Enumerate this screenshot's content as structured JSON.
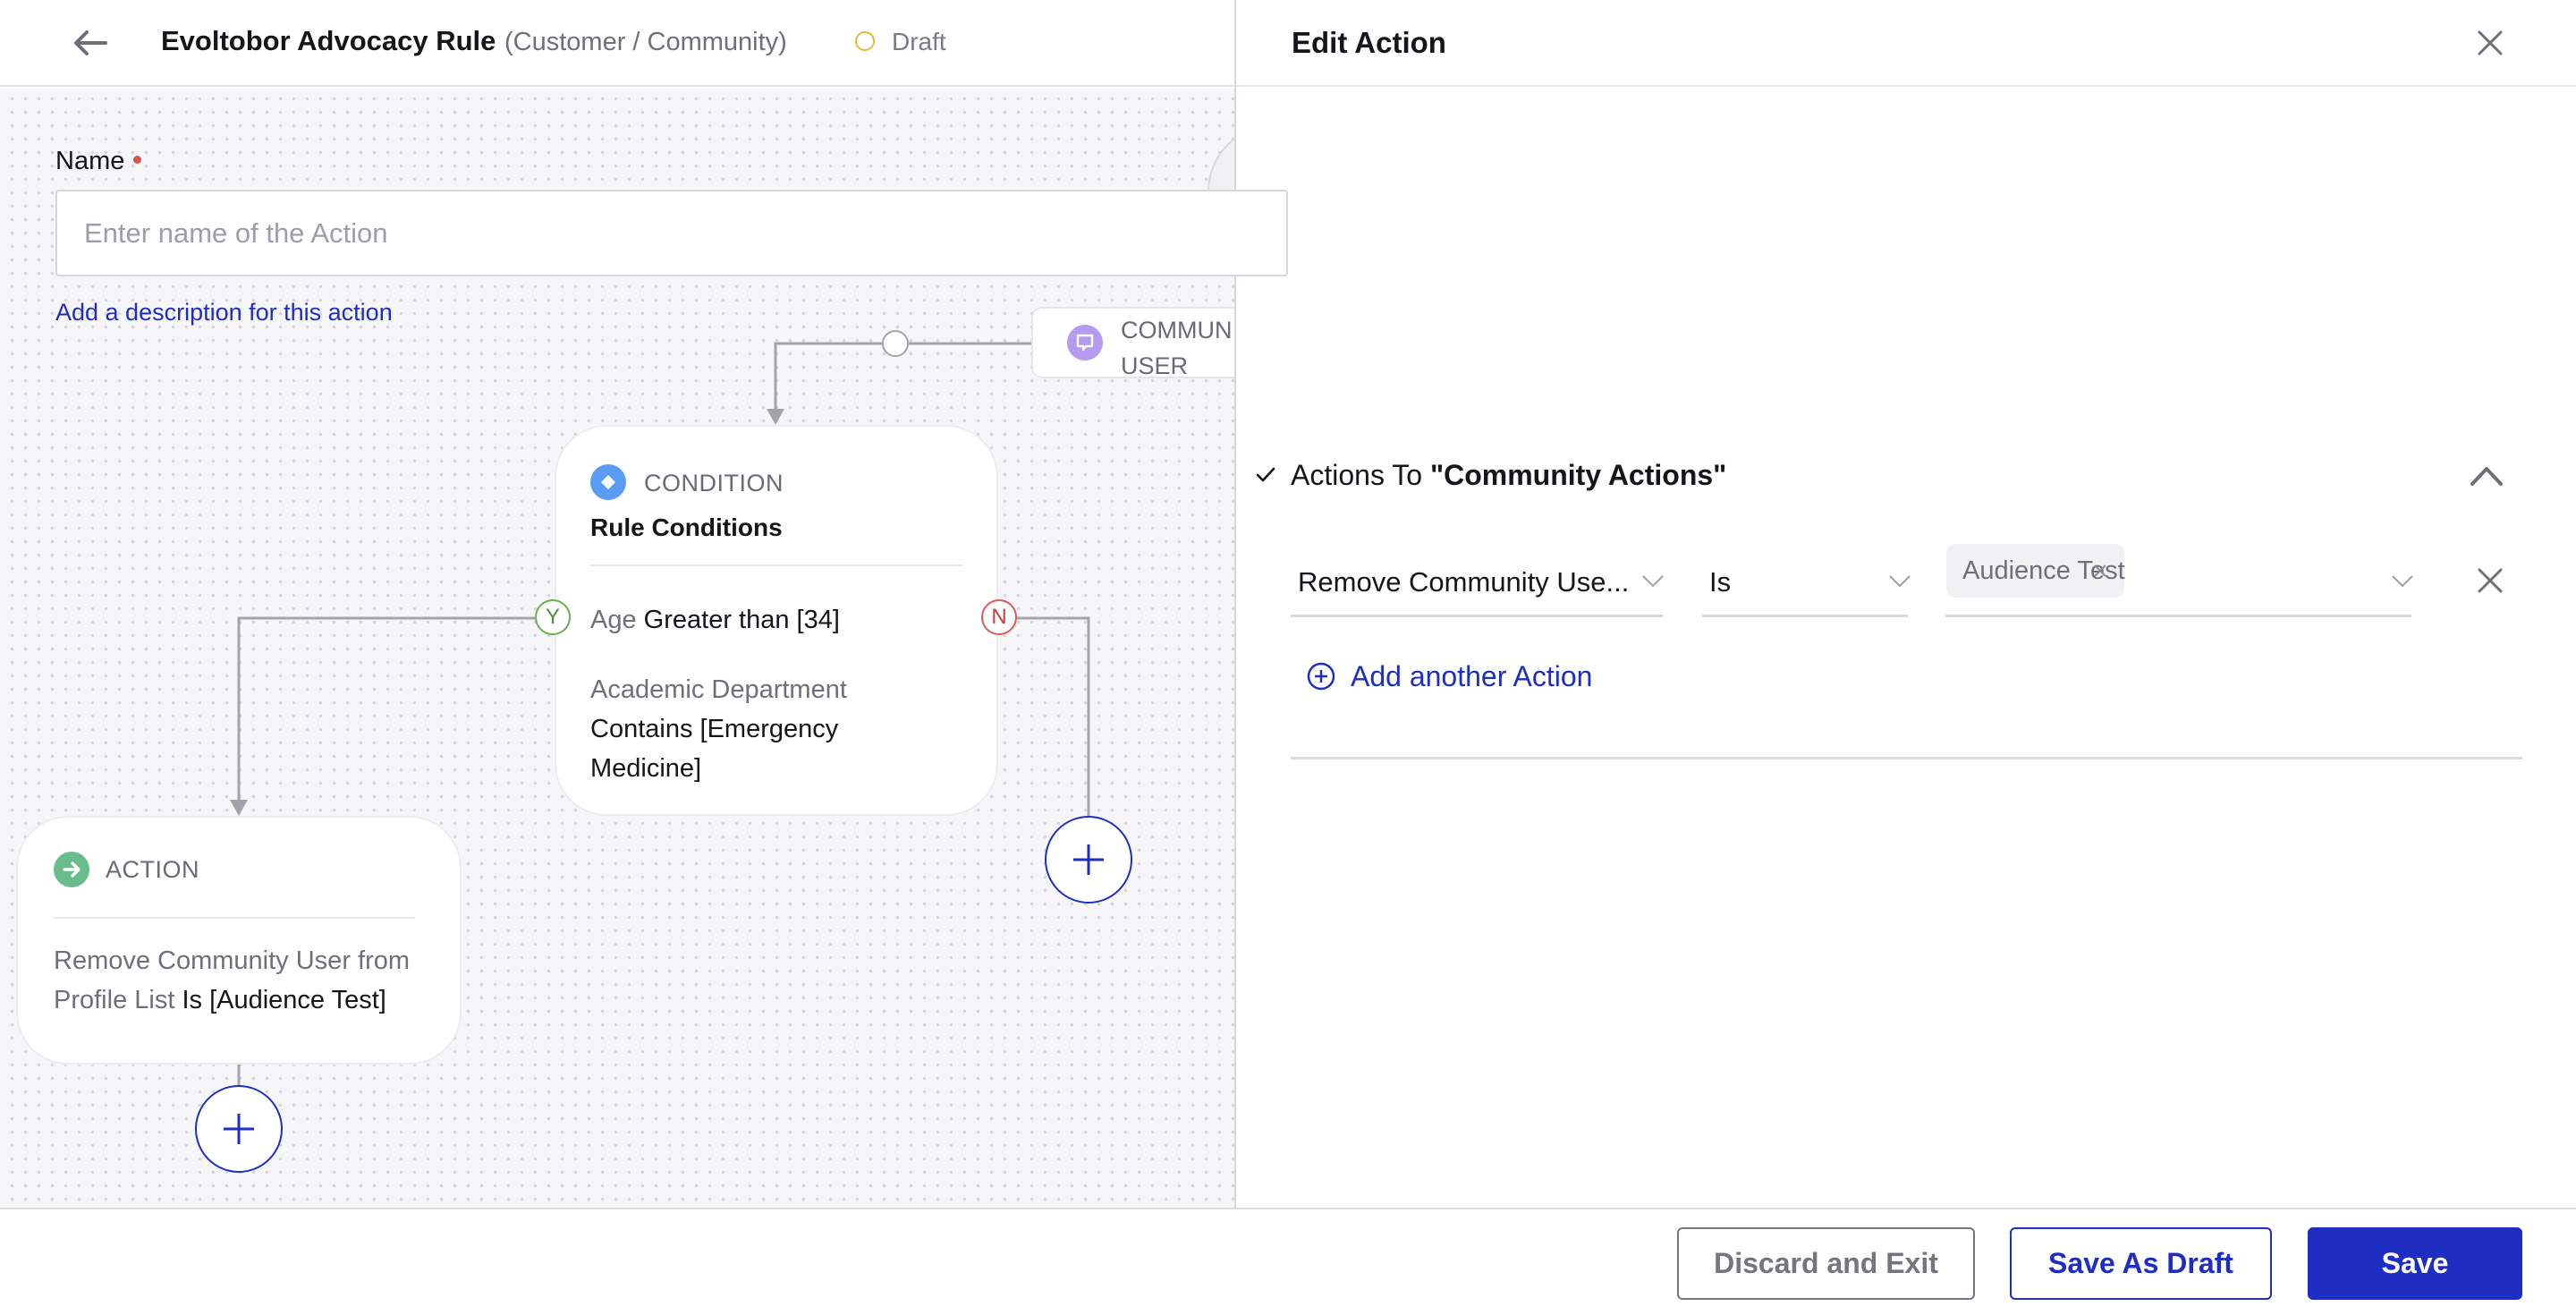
{
  "header": {
    "back_icon": "arrow-left-icon",
    "title": "Evoltobor Advocacy Rule",
    "subtitle": "(Customer / Community)",
    "status": "Draft",
    "status_color": "#e6b93a"
  },
  "canvas": {
    "trigger_node": {
      "icon": "chat-bubble-icon",
      "label": "COMMUN\nUSER",
      "icon_color": "#b59af0"
    },
    "condition_card": {
      "type": "CONDITION",
      "icon": "diamond-icon",
      "icon_color": "#5a9cf2",
      "title": "Rule Conditions",
      "conditions": [
        {
          "field": "Age",
          "rule": "Greater than [34]"
        },
        {
          "field": "Academic Department",
          "rule": "Contains [Emergency Medicine]"
        }
      ],
      "yes_label": "Y",
      "no_label": "N"
    },
    "action_card": {
      "type": "ACTION",
      "icon": "arrow-right-circle-icon",
      "icon_color": "#69bd8c",
      "description_muted": "Remove Community User from Profile List",
      "description_value": "Is [Audience Test]"
    },
    "add_node_icon": "plus-icon"
  },
  "panel": {
    "title": "Edit Action",
    "close_icon": "close-icon",
    "name_label": "Name",
    "name_value": "",
    "name_placeholder": "Enter name of the Action",
    "description_link": "Add a description for this action",
    "actions_section": {
      "prefix": "Actions To ",
      "target": "\"Community Actions\"",
      "collapse_icon": "chevron-up-icon",
      "rows": [
        {
          "field": "Remove Community Use...",
          "operator": "Is",
          "values": [
            "Audience Test"
          ]
        }
      ],
      "add_label": "Add another Action"
    }
  },
  "footer": {
    "discard": "Discard and Exit",
    "save_draft": "Save As Draft",
    "save": "Save",
    "accent_color": "#1f2ec2"
  }
}
